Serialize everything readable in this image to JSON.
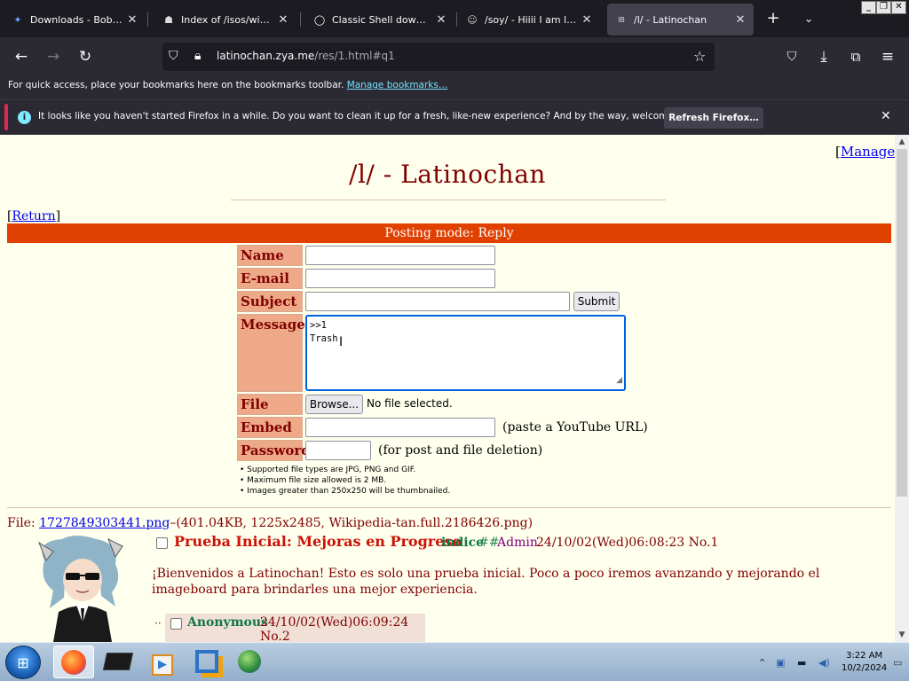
{
  "browser": {
    "tabs": [
      {
        "title": "Downloads - Bob Pony",
        "icon": "bob-pony-icon"
      },
      {
        "title": "Index of /isos/windows/",
        "icon": "index-server-icon"
      },
      {
        "title": "Classic Shell download |",
        "icon": "classic-shell-icon"
      },
      {
        "title": "/soy/ - Hiiii I am latinx a",
        "icon": "soyjak-icon"
      },
      {
        "title": "/l/ - Latinochan",
        "icon": "board-icon"
      }
    ],
    "url_host": "latinochan.zya.me",
    "url_path": "/res/1.html#q1",
    "bookmarks_text": "For quick access, place your bookmarks here on the bookmarks toolbar.",
    "bookmarks_link": "Manage bookmarks…",
    "notification_text": "It looks like you haven't started Firefox in a while. Do you want to clean it up for a fresh, like-new experience? And by the way, welcome back!",
    "notification_button": "Refresh Firefox…",
    "accent_color": "#0060df"
  },
  "page": {
    "manage_link": "Manage",
    "board_title": "/l/ - Latinochan",
    "return_link": "Return",
    "posting_mode": "Posting mode: Reply",
    "form": {
      "name_label": "Name",
      "email_label": "E-mail",
      "subject_label": "Subject",
      "submit_label": "Submit",
      "message_label": "Message",
      "message_value": ">>1\nTrash",
      "file_label": "File",
      "browse_label": "Browse...",
      "no_file_text": "No file selected.",
      "embed_label": "Embed",
      "embed_hint": "(paste a YouTube URL)",
      "password_label": "Password",
      "password_hint": "(for post and file deletion)"
    },
    "rules": [
      "Supported file types are JPG, PNG and GIF.",
      "Maximum file size allowed is 2 MB.",
      "Images greater than 250x250 will be thumbnailed."
    ],
    "op": {
      "file_prefix": "File:",
      "file_name": "1727849303441.png",
      "file_info": "–(401.04KB, 1225x2485, Wikipedia-tan.full.2186426.png)",
      "subject": "Prueba Inicial: Mejoras en Progreso",
      "name": "indice",
      "tripcode": "##",
      "capcode": "Admin",
      "meta": "24/10/02(Wed)06:08:23 No.1",
      "body": "¡Bienvenidos a Latinochan! Esto es solo una prueba inicial. Poco a poco iremos avanzando y mejorando el imageboard para brindarles una mejor experiencia."
    },
    "reply": {
      "arrow": "··",
      "name": "Anonymous",
      "meta": "24/10/02(Wed)06:09:24 No.2"
    }
  },
  "taskbar": {
    "time": "3:22 AM",
    "date": "10/2/2024"
  }
}
